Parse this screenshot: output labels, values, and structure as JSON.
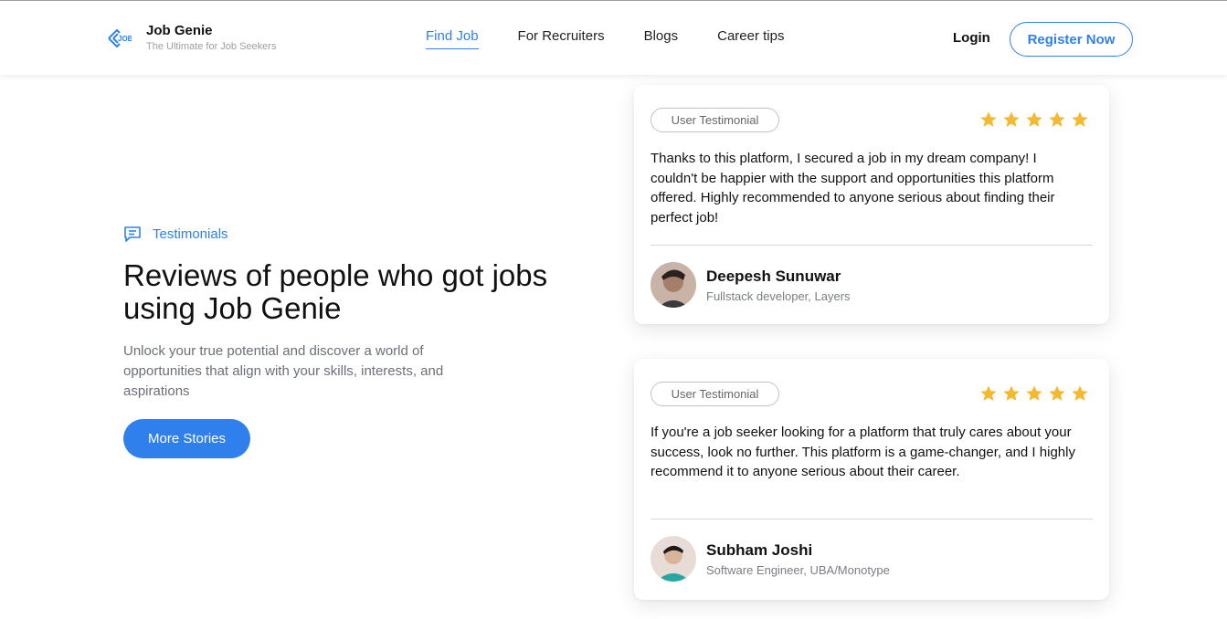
{
  "header": {
    "brand_name": "Job Genie",
    "brand_tagline": "The Ultimate for Job Seekers",
    "logo_icon": "job-genie-logo-icon",
    "nav": [
      {
        "label": "Find Job",
        "active": true
      },
      {
        "label": "For Recruiters",
        "active": false
      },
      {
        "label": "Blogs",
        "active": false
      },
      {
        "label": "Career tips",
        "active": false
      }
    ],
    "login_label": "Login",
    "register_label": "Register Now"
  },
  "hero": {
    "section_label": "Testimonials",
    "section_icon": "chat-icon",
    "headline": "Reviews of people who got jobs using Job Genie",
    "subtext": "Unlock your true potential and discover a world of opportunities that align with your skills, interests, and aspirations",
    "button_label": "More Stories"
  },
  "testimonials": [
    {
      "badge": "User Testimonial",
      "rating": 5,
      "quote": "Thanks to this platform, I secured a job in my dream company! I couldn't be happier with the support and opportunities this platform offered. Highly recommended to anyone serious about finding their perfect job!",
      "name": "Deepesh Sunuwar",
      "role": "Fullstack developer, Layers"
    },
    {
      "badge": "User Testimonial",
      "rating": 5,
      "quote": "If you're a job seeker looking for a platform that truly cares about your success, look no further. This platform is a game-changer, and I highly recommend it to anyone serious about their career.",
      "name": "Subham Joshi",
      "role": "Software Engineer, UBA/Monotype"
    }
  ],
  "colors": {
    "accent": "#2f80ed",
    "star": "#f5b82e",
    "muted_text": "#6b6f76"
  }
}
